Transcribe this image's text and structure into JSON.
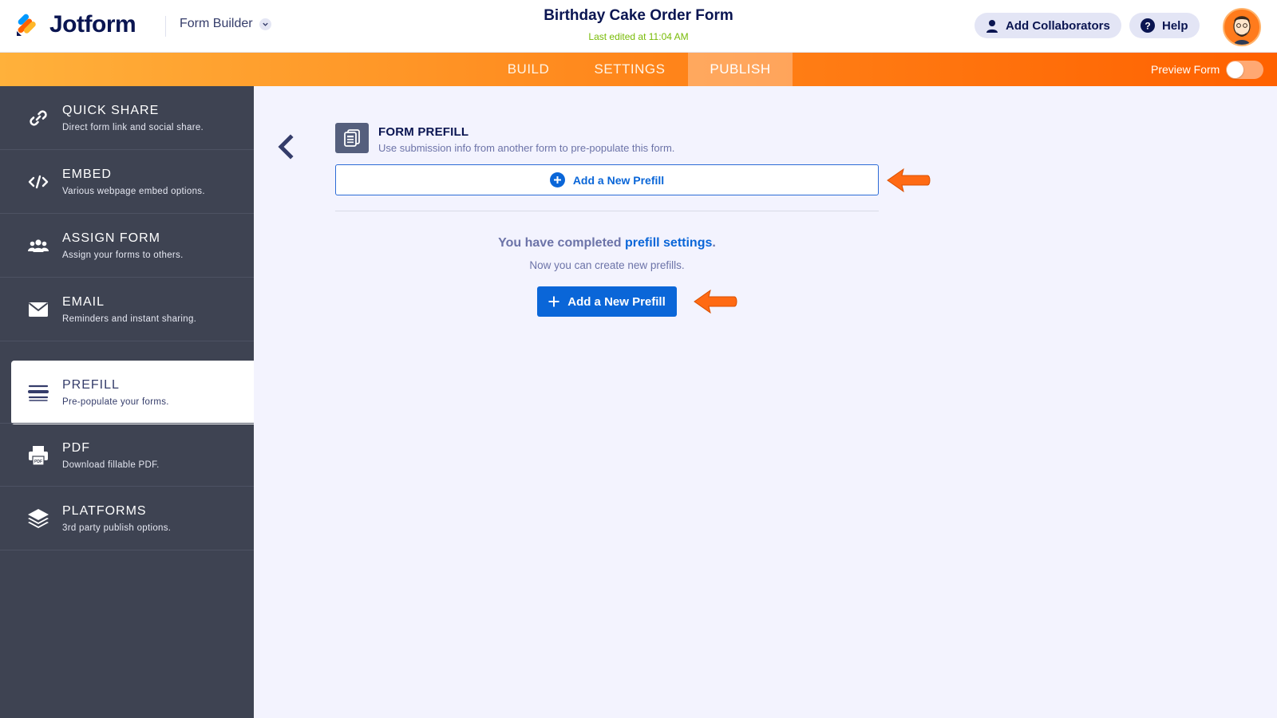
{
  "header": {
    "brand": "Jotform",
    "form_builder_label": "Form Builder",
    "form_title": "Birthday Cake Order Form",
    "last_edited": "Last edited at 11:04 AM",
    "add_collaborators": "Add Collaborators",
    "help": "Help"
  },
  "nav": {
    "tabs": [
      {
        "label": "BUILD"
      },
      {
        "label": "SETTINGS"
      },
      {
        "label": "PUBLISH",
        "active": true
      }
    ],
    "preview_label": "Preview Form",
    "preview_on": false
  },
  "sidebar": {
    "items": [
      {
        "title": "QUICK SHARE",
        "desc": "Direct form link and social share.",
        "icon": "link-icon"
      },
      {
        "title": "EMBED",
        "desc": "Various webpage embed options.",
        "icon": "code-icon"
      },
      {
        "title": "ASSIGN FORM",
        "desc": "Assign your forms to others.",
        "icon": "users-icon"
      },
      {
        "title": "EMAIL",
        "desc": "Reminders and instant sharing.",
        "icon": "envelope-icon"
      },
      {
        "title": "PREFILL",
        "desc": "Pre-populate your forms.",
        "icon": "prefill-icon",
        "active": true
      },
      {
        "title": "PDF",
        "desc": "Download fillable PDF.",
        "icon": "pdf-icon"
      },
      {
        "title": "PLATFORMS",
        "desc": "3rd party publish options.",
        "icon": "layers-icon"
      }
    ]
  },
  "main": {
    "section_title": "FORM PREFILL",
    "section_subtitle": "Use submission info from another form to pre-populate this form.",
    "add_prefill_outline": "Add a New Prefill",
    "completed_prefix": "You have completed ",
    "completed_link": "prefill settings",
    "completed_suffix": ".",
    "now_text": "Now you can create new prefills.",
    "add_prefill_primary": "Add a New Prefill"
  },
  "colors": {
    "accent_blue": "#0a66d8",
    "nav_orange": "#ff8a1e",
    "sidebar_bg": "#3e4352",
    "arrow_orange": "#ff6a13",
    "edited_green": "#78bb07"
  }
}
